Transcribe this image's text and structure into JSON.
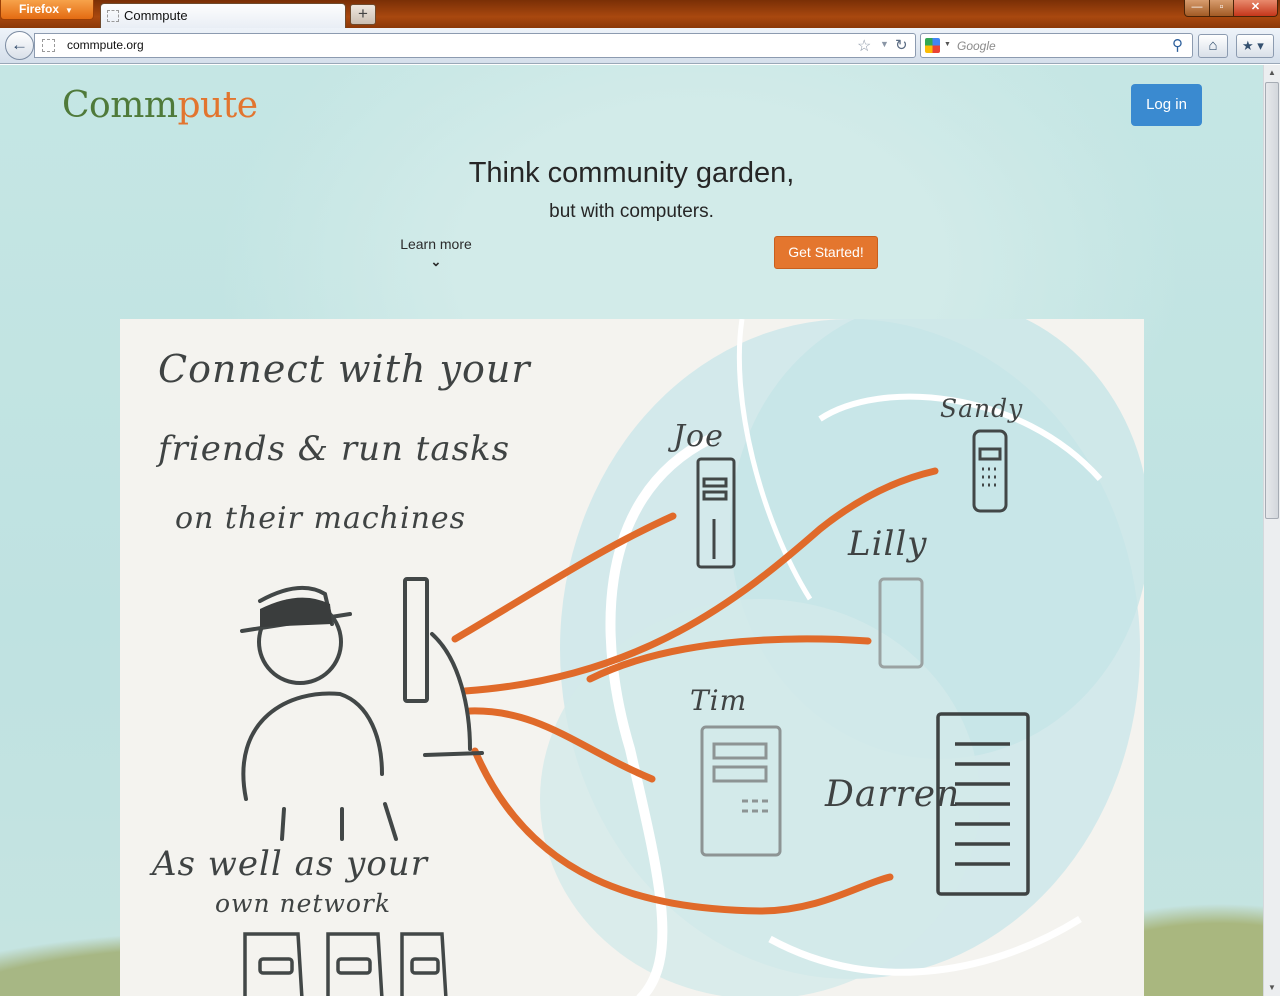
{
  "browser": {
    "app_button": "Firefox",
    "tab_title": "Commpute",
    "url": "commpute.org",
    "search_placeholder": "Google",
    "window_controls": {
      "minimize": "—",
      "maximize": "▫",
      "close": "✕"
    }
  },
  "page": {
    "logo": {
      "part1": "Comm",
      "part2": "pute"
    },
    "login_label": "Log in",
    "hero": {
      "title": "Think community garden,",
      "subtitle": "but with computers."
    },
    "learn_more_label": "Learn more",
    "cta_label": "Get Started!",
    "sketch": {
      "lines": [
        "Connect with your",
        "friends & run tasks",
        "on their machines",
        "As well as your",
        "own network"
      ],
      "names": [
        "Joe",
        "Sandy",
        "Lilly",
        "Tim",
        "Darren"
      ]
    }
  },
  "colors": {
    "logo_green": "#4f7a3a",
    "logo_orange": "#e2752f",
    "login_blue": "#3a8ad0",
    "cta_orange": "#e4762e",
    "link_orange": "#e06a2a"
  },
  "icons": {
    "back": "back-arrow-icon",
    "star": "bookmark-star-icon",
    "reload": "reload-icon",
    "search": "magnifier-icon",
    "home": "home-icon",
    "bookmarks": "bookmarks-icon",
    "chevron": "chevron-down-icon"
  }
}
